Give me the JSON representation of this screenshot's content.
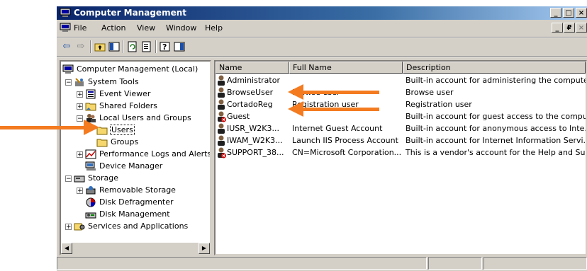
{
  "window": {
    "title": "Computer Management",
    "controls": [
      "_",
      "□",
      "×"
    ],
    "mdi_controls": [
      "_",
      "₽",
      "×"
    ]
  },
  "menu": [
    {
      "label": "File"
    },
    {
      "label": "Action"
    },
    {
      "label": "View"
    },
    {
      "label": "Window"
    },
    {
      "label": "Help"
    }
  ],
  "toolbar": {
    "buttons": [
      "back-icon",
      "forward-icon",
      "up-folder-icon",
      "show-tree-icon",
      "properties-icon",
      "refresh-icon",
      "export-icon",
      "help-icon",
      "view-icon"
    ]
  },
  "tree": {
    "root": "Computer Management (Local)",
    "system_tools": "System Tools",
    "event_viewer": "Event Viewer",
    "shared_folders": "Shared Folders",
    "local_users": "Local Users and Groups",
    "users": "Users",
    "groups": "Groups",
    "perf_logs": "Performance Logs and Alerts",
    "device_manager": "Device Manager",
    "storage": "Storage",
    "removable": "Removable Storage",
    "defrag": "Disk Defragmenter",
    "disk_mgmt": "Disk Management",
    "services": "Services and Applications",
    "selected": "Users"
  },
  "list": {
    "columns": [
      "Name",
      "Full Name",
      "Description"
    ],
    "rows": [
      {
        "name": "Administrator",
        "full": "",
        "desc": "Built-in account for administering the compute...",
        "disabled": false
      },
      {
        "name": "BrowseUser",
        "full": "Browse user",
        "desc": "Browse user",
        "disabled": false
      },
      {
        "name": "CortadoReg",
        "full": "Registration user",
        "desc": "Registration user",
        "disabled": false
      },
      {
        "name": "Guest",
        "full": "",
        "desc": "Built-in account for guest access to the compu...",
        "disabled": true
      },
      {
        "name": "IUSR_W2K3...",
        "full": "Internet Guest Account",
        "desc": "Built-in account for anonymous access to Inte...",
        "disabled": false
      },
      {
        "name": "IWAM_W2K3...",
        "full": "Launch IIS Process Account",
        "desc": "Built-in account for Internet Information Servi...",
        "disabled": false
      },
      {
        "name": "SUPPORT_38...",
        "full": "CN=Microsoft Corporation...",
        "desc": "This is a vendor's account for the Help and Su...",
        "disabled": true
      }
    ]
  },
  "annotations": {
    "arrow_color": "#f47b20"
  }
}
